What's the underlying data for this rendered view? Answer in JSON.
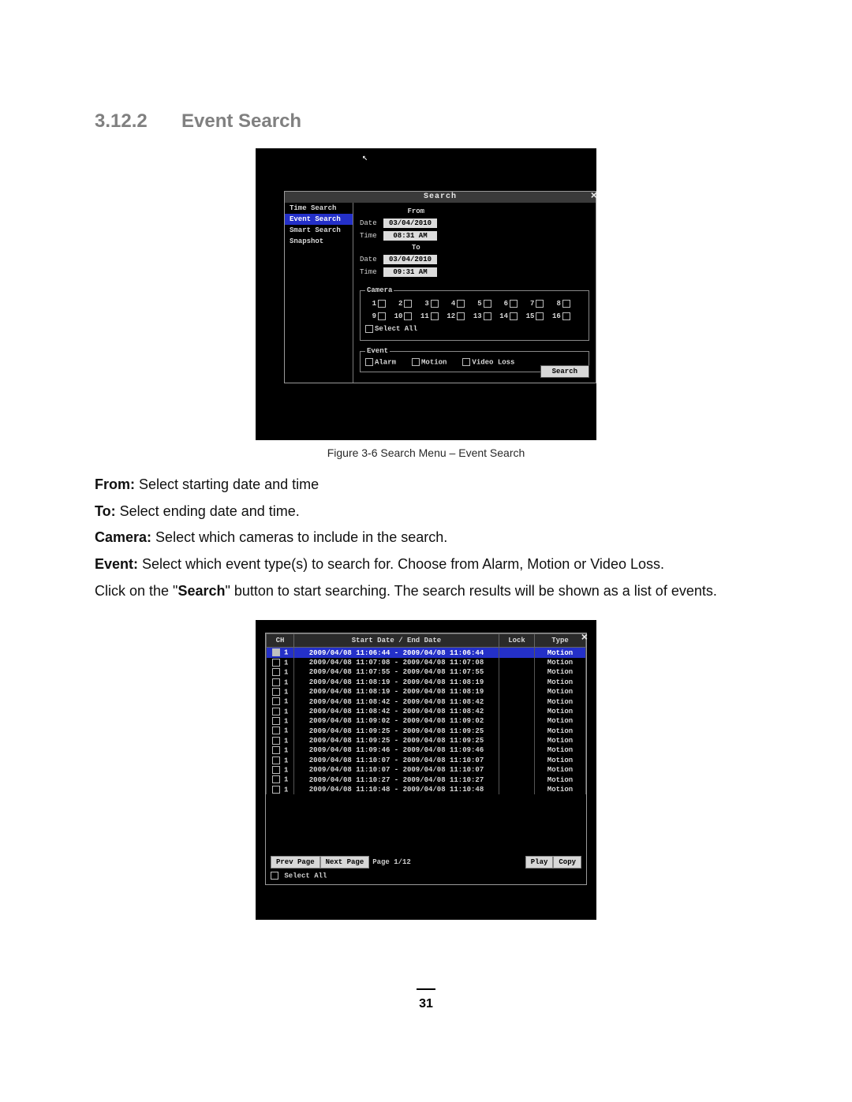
{
  "section": {
    "number": "3.12.2",
    "title": "Event Search"
  },
  "caption1": "Figure 3-6 Search Menu – Event Search",
  "desc": {
    "from": {
      "label": "From:",
      "text": " Select starting date and time"
    },
    "to": {
      "label": "To:",
      "text": " Select ending date and time."
    },
    "camera": {
      "label": "Camera:",
      "text": " Select which cameras to include in the search."
    },
    "event": {
      "label": "Event:",
      "text": " Select which event type(s) to search for. Choose from Alarm, Motion or Video Loss."
    },
    "click_pre": "Click on the \"",
    "click_btn": "Search",
    "click_post": "\" button to start searching. The search results will be shown as a list of events."
  },
  "page_number": "31",
  "dlg": {
    "title": "Search",
    "side": [
      "Time Search",
      "Event Search",
      "Smart Search",
      "Snapshot"
    ],
    "side_selected": 1,
    "from": {
      "hd": "From",
      "date_label": "Date",
      "date": "03/04/2010",
      "time_label": "Time",
      "time": "08:31 AM"
    },
    "to": {
      "hd": "To",
      "date_label": "Date",
      "date": "03/04/2010",
      "time_label": "Time",
      "time": "09:31 AM"
    },
    "camera_legend": "Camera",
    "camera_nums": [
      "1",
      "2",
      "3",
      "4",
      "5",
      "6",
      "7",
      "8",
      "9",
      "10",
      "11",
      "12",
      "13",
      "14",
      "15",
      "16"
    ],
    "select_all": "Select All",
    "event_legend": "Event",
    "event_opts": [
      "Alarm",
      "Motion",
      "Video Loss"
    ],
    "search_btn": "Search"
  },
  "results": {
    "headers": {
      "ch": "CH",
      "date": "Start Date / End Date",
      "lock": "Lock",
      "type": "Type"
    },
    "rows": [
      {
        "ch": "1",
        "d": "2009/04/08 11:06:44 - 2009/04/08 11:06:44",
        "t": "Motion",
        "sel": true
      },
      {
        "ch": "1",
        "d": "2009/04/08 11:07:08 - 2009/04/08 11:07:08",
        "t": "Motion"
      },
      {
        "ch": "1",
        "d": "2009/04/08 11:07:55 - 2009/04/08 11:07:55",
        "t": "Motion"
      },
      {
        "ch": "1",
        "d": "2009/04/08 11:08:19 - 2009/04/08 11:08:19",
        "t": "Motion"
      },
      {
        "ch": "1",
        "d": "2009/04/08 11:08:19 - 2009/04/08 11:08:19",
        "t": "Motion"
      },
      {
        "ch": "1",
        "d": "2009/04/08 11:08:42 - 2009/04/08 11:08:42",
        "t": "Motion"
      },
      {
        "ch": "1",
        "d": "2009/04/08 11:08:42 - 2009/04/08 11:08:42",
        "t": "Motion"
      },
      {
        "ch": "1",
        "d": "2009/04/08 11:09:02 - 2009/04/08 11:09:02",
        "t": "Motion"
      },
      {
        "ch": "1",
        "d": "2009/04/08 11:09:25 - 2009/04/08 11:09:25",
        "t": "Motion"
      },
      {
        "ch": "1",
        "d": "2009/04/08 11:09:25 - 2009/04/08 11:09:25",
        "t": "Motion"
      },
      {
        "ch": "1",
        "d": "2009/04/08 11:09:46 - 2009/04/08 11:09:46",
        "t": "Motion"
      },
      {
        "ch": "1",
        "d": "2009/04/08 11:10:07 - 2009/04/08 11:10:07",
        "t": "Motion"
      },
      {
        "ch": "1",
        "d": "2009/04/08 11:10:07 - 2009/04/08 11:10:07",
        "t": "Motion"
      },
      {
        "ch": "1",
        "d": "2009/04/08 11:10:27 - 2009/04/08 11:10:27",
        "t": "Motion"
      },
      {
        "ch": "1",
        "d": "2009/04/08 11:10:48 - 2009/04/08 11:10:48",
        "t": "Motion"
      }
    ],
    "prev": "Prev Page",
    "next": "Next Page",
    "page": "Page 1/12",
    "play": "Play",
    "copy": "Copy",
    "select_all": "Select All"
  }
}
